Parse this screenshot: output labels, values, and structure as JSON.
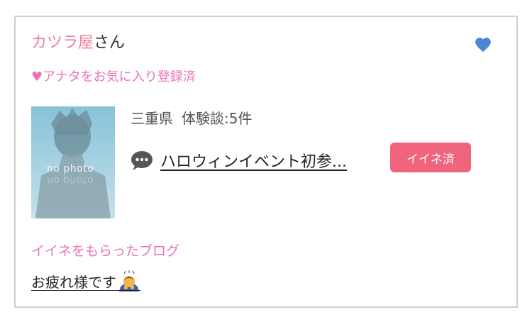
{
  "card": {
    "shop_name": "カツラ屋",
    "shop_suffix": "さん",
    "favorite_status": "♥アナタをお気に入り登録済",
    "photo_placeholder": "no photo",
    "prefecture": "三重県",
    "experience_count": "体験談:5件",
    "post_title": "ハロウィンイベント初参...",
    "iine_badge": "イイネ済",
    "liked_blog_label": "イイネをもらったブログ",
    "liked_blog_title": "お疲れ様です"
  },
  "colors": {
    "pink_text": "#ef7d9a",
    "magenta_text": "#e975b8",
    "heart_blue": "#4a86d4",
    "badge_bg": "#f0647e",
    "border": "#cfcfcf"
  },
  "icons": {
    "favorite": "heart-icon",
    "comment": "speech-bubble-icon",
    "emoji": "bowing-person-emoji"
  }
}
